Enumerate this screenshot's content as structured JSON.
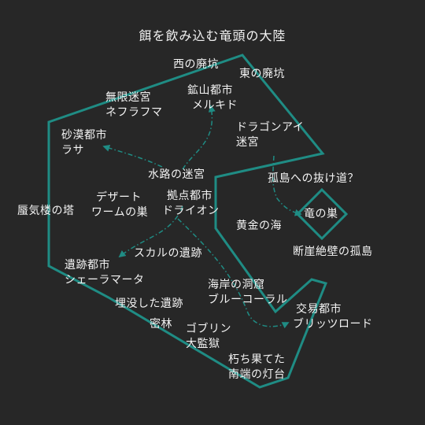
{
  "map": {
    "title": "餌を飲み込む竜頭の大陸",
    "colors": {
      "background": "#272727",
      "outline": "#1f8c84",
      "text": "#f3f3f3"
    },
    "places": {
      "west_mine": "西の廃坑",
      "east_mine": "東の廃坑",
      "nefurafuma": [
        "無限迷宮",
        "ネフラフマ"
      ],
      "merukido": [
        "鉱山都市",
        "メルキド"
      ],
      "dragon_eye": [
        "ドラゴンアイ",
        "迷宮"
      ],
      "rasa": [
        "砂漠都市",
        "ラサ"
      ],
      "waterway": "水路の迷宮",
      "lone_passage": "孤島への抜け道？",
      "sandworm": [
        "デザート",
        "ワームの巣"
      ],
      "drion": [
        "拠点都市",
        "ドライオン"
      ],
      "mirage_tower": "蜃気楼の塔",
      "dragon_nest": "竜の巣",
      "golden_sea": "黄金の海",
      "cliff_island": "断崖絶壁の孤島",
      "skull_ruins": "スカルの遺跡",
      "shelamata": [
        "遺跡都市",
        "シェーラマータ"
      ],
      "coastal_cave": [
        "海岸の洞窟",
        "ブルーコーラル"
      ],
      "buried_ruins": "埋没した遺跡",
      "britzroad": [
        "交易都市",
        "ブリッツロード"
      ],
      "jungle": "密林",
      "goblin_prison": [
        "ゴブリン",
        "大監獄"
      ],
      "lighthouse": [
        "朽ち果てた",
        "南端の灯台"
      ]
    }
  }
}
